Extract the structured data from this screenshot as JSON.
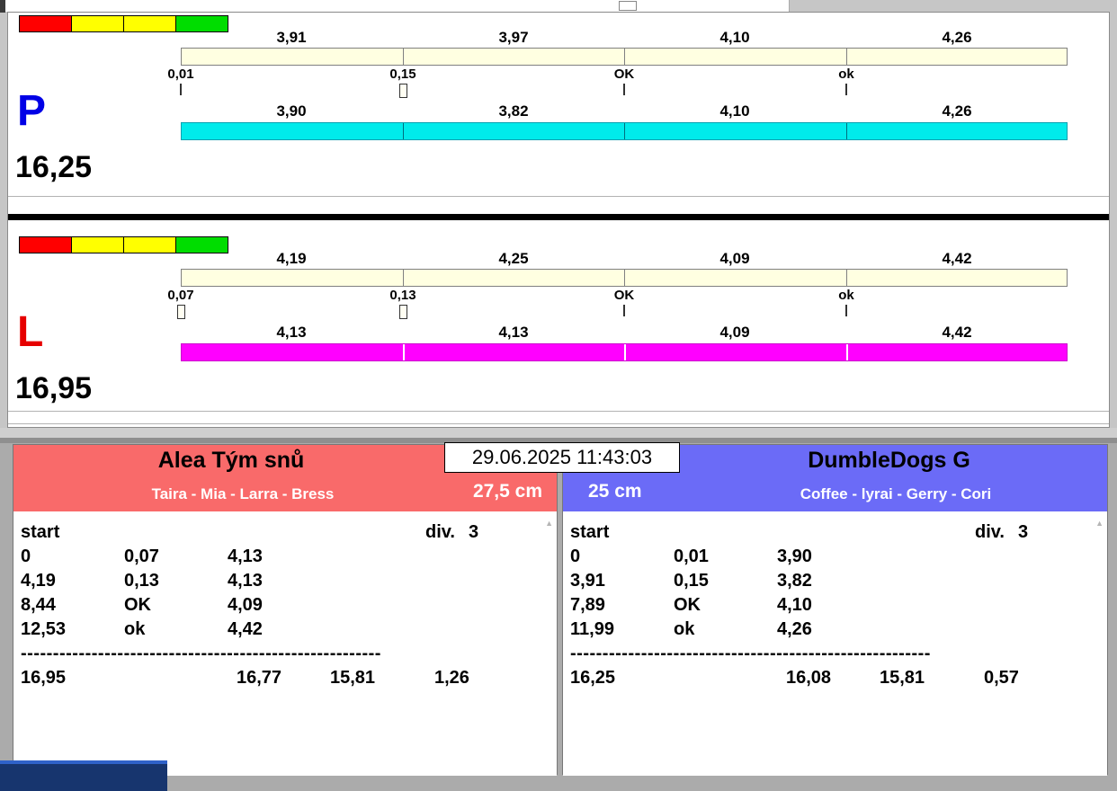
{
  "colors": {
    "reference_bar": "#ffffe1",
    "lane_p_bar": "#00ebeb",
    "lane_l_bar": "#ff00ff",
    "letter_p": "#0000e6",
    "letter_l": "#e60000",
    "team_left_header": "#f96a6a",
    "team_right_header": "#6b6bf7",
    "light_red": "#ff0000",
    "light_yellow": "#ffff00",
    "light_green": "#00dd00"
  },
  "datetime": "29.06.2025 11:43:03",
  "lanes": [
    {
      "letter": "P",
      "total": "16,25",
      "top_values": [
        "3,91",
        "3,97",
        "4,10",
        "4,26"
      ],
      "ticks": [
        {
          "label": "0,01",
          "marker": "line"
        },
        {
          "label": "0,15",
          "marker": "box"
        },
        {
          "label": "OK",
          "marker": "line"
        },
        {
          "label": "ok",
          "marker": "line"
        }
      ],
      "bottom_values": [
        "3,90",
        "3,82",
        "4,10",
        "4,26"
      ]
    },
    {
      "letter": "L",
      "total": "16,95",
      "top_values": [
        "4,19",
        "4,25",
        "4,09",
        "4,42"
      ],
      "ticks": [
        {
          "label": "0,07",
          "marker": "box"
        },
        {
          "label": "0,13",
          "marker": "box"
        },
        {
          "label": "OK",
          "marker": "line"
        },
        {
          "label": "ok",
          "marker": "line"
        }
      ],
      "bottom_values": [
        "4,13",
        "4,13",
        "4,09",
        "4,42"
      ]
    }
  ],
  "teams": [
    {
      "name": "Alea Tým snů",
      "dogs": "Taira - Mia - Larra - Bress",
      "height": "27,5 cm",
      "start_label": "start",
      "div_label": "div.",
      "div_value": "3",
      "rows": [
        {
          "c1": "0",
          "c2": "0,07",
          "c3": "4,13"
        },
        {
          "c1": "4,19",
          "c2": "0,13",
          "c3": "4,13"
        },
        {
          "c1": "8,44",
          "c2": "OK",
          "c3": "4,09"
        },
        {
          "c1": "12,53",
          "c2": "ok",
          "c3": "4,42"
        }
      ],
      "separator": "--------------------------------------------------------",
      "totals": {
        "t1": "16,95",
        "t2": "16,77",
        "t3": "15,81",
        "t4": "1,26"
      }
    },
    {
      "name": "DumbleDogs G",
      "dogs": "Coffee - lyrai - Gerry - Cori",
      "height": "25 cm",
      "start_label": "start",
      "div_label": "div.",
      "div_value": "3",
      "rows": [
        {
          "c1": "0",
          "c2": "0,01",
          "c3": "3,90"
        },
        {
          "c1": "3,91",
          "c2": "0,15",
          "c3": "3,82"
        },
        {
          "c1": "7,89",
          "c2": "OK",
          "c3": "4,10"
        },
        {
          "c1": "11,99",
          "c2": "ok",
          "c3": "4,26"
        }
      ],
      "separator": "--------------------------------------------------------",
      "totals": {
        "t1": "16,25",
        "t2": "16,08",
        "t3": "15,81",
        "t4": "0,57"
      }
    }
  ]
}
